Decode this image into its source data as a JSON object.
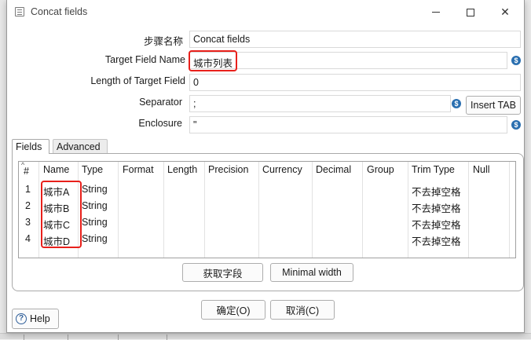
{
  "window": {
    "title": "Concat fields"
  },
  "form": {
    "step_name_label": "步骤名称",
    "step_name_value": "Concat fields",
    "target_field_label": "Target Field Name",
    "target_field_value": "城市列表",
    "length_label": "Length of Target Field",
    "length_value": "0",
    "separator_label": "Separator",
    "separator_value": ";",
    "insert_tab_label": "Insert TAB",
    "enclosure_label": "Enclosure",
    "enclosure_value": "\""
  },
  "tabs": [
    {
      "label": "Fields",
      "active": true
    },
    {
      "label": "Advanced",
      "active": false
    }
  ],
  "table": {
    "columns": [
      "#",
      "Name",
      "Type",
      "Format",
      "Length",
      "Precision",
      "Currency",
      "Decimal",
      "Group",
      "Trim Type",
      "Null"
    ],
    "rows": [
      [
        "1",
        "城市A",
        "String",
        "",
        "",
        "",
        "",
        "",
        "",
        "不去掉空格",
        ""
      ],
      [
        "2",
        "城市B",
        "String",
        "",
        "",
        "",
        "",
        "",
        "",
        "不去掉空格",
        ""
      ],
      [
        "3",
        "城市C",
        "String",
        "",
        "",
        "",
        "",
        "",
        "",
        "不去掉空格",
        ""
      ],
      [
        "4",
        "城市D",
        "String",
        "",
        "",
        "",
        "",
        "",
        "",
        "不去掉空格",
        ""
      ]
    ]
  },
  "buttons": {
    "get_fields": "获取字段",
    "minimal_width": "Minimal width",
    "ok": "确定(O)",
    "cancel": "取消(C)",
    "help": "Help"
  },
  "colors": {
    "highlight": "#e8201b",
    "variable_icon": "#2a6fb0"
  }
}
